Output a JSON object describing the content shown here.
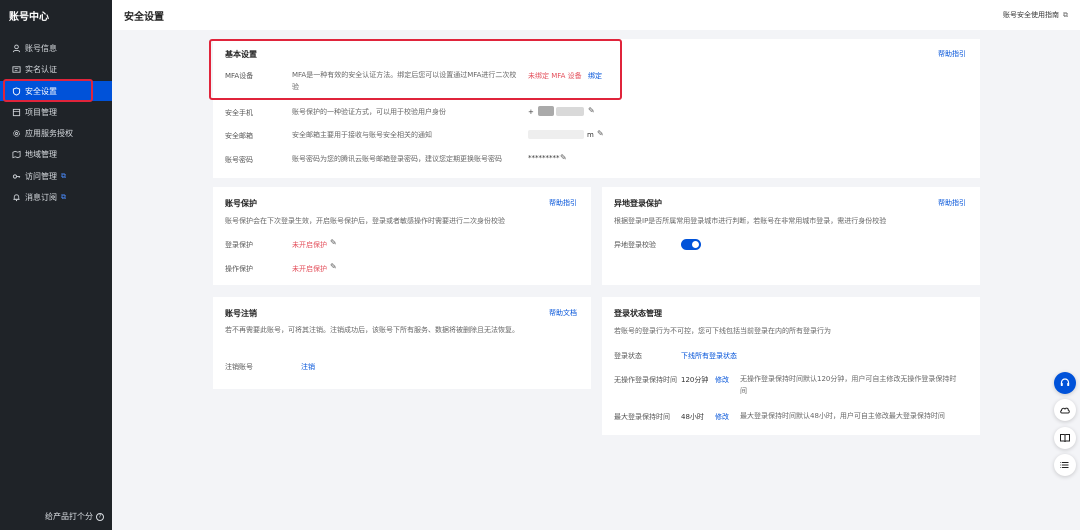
{
  "sidebar": {
    "title": "账号中心",
    "items": [
      {
        "label": "账号信息",
        "icon": "user-icon",
        "active": false,
        "external": false
      },
      {
        "label": "实名认证",
        "icon": "id-card-icon",
        "active": false,
        "external": false
      },
      {
        "label": "安全设置",
        "icon": "shield-icon",
        "active": true,
        "external": false
      },
      {
        "label": "项目管理",
        "icon": "folder-icon",
        "active": false,
        "external": false
      },
      {
        "label": "应用服务授权",
        "icon": "gear-icon",
        "active": false,
        "external": false
      },
      {
        "label": "地域管理",
        "icon": "map-icon",
        "active": false,
        "external": false
      },
      {
        "label": "访问管理",
        "icon": "key-icon",
        "active": false,
        "external": true
      },
      {
        "label": "消息订阅",
        "icon": "bell-icon",
        "active": false,
        "external": true
      }
    ],
    "footer": "给产品打个分",
    "footer_icon": "?"
  },
  "header": {
    "title": "安全设置",
    "guide_link": "账号安全使用指南",
    "external_icon": "⧉"
  },
  "basic": {
    "title": "基本设置",
    "help": "帮助指引",
    "mfa": {
      "label": "MFA设备",
      "desc": "MFA是一种有效的安全认证方法。绑定后您可以设置通过MFA进行二次校验",
      "status": "未绑定 MFA 设备",
      "action": "绑定"
    },
    "phone": {
      "label": "安全手机",
      "desc": "账号保护的一种验证方式，可以用于校验用户身份",
      "value": "+"
    },
    "email": {
      "label": "安全邮箱",
      "desc": "安全邮箱主要用于接收与账号安全相关的通知",
      "value": "m"
    },
    "password": {
      "label": "账号密码",
      "desc": "账号密码为您的腾讯云账号邮箱登录密码，建议您定期更换账号密码",
      "value": "*********"
    }
  },
  "protect": {
    "title": "账号保护",
    "help": "帮助指引",
    "desc": "账号保护会在下次登录生效，开启账号保护后，登录或者敏感操作时需要进行二次身份校验",
    "login": {
      "label": "登录保护",
      "status": "未开启保护"
    },
    "op": {
      "label": "操作保护",
      "status": "未开启保护"
    }
  },
  "remote": {
    "title": "异地登录保护",
    "help": "帮助指引",
    "desc": "根据登录IP是否所属常用登录城市进行判断，若账号在非常用城市登录，需进行身份校验",
    "toggle_label": "异地登录校验",
    "enabled": true
  },
  "cancel": {
    "title": "账号注销",
    "help": "帮助文档",
    "desc": "若不再需要此账号，可将其注销。注销成功后，该账号下所有服务、数据将被删除且无法恢复。",
    "label": "注销账号",
    "action": "注销"
  },
  "session": {
    "title": "登录状态管理",
    "desc": "若账号的登录行为不可控，您可下线包括当前登录在内的所有登录行为",
    "status_label": "登录状态",
    "status_action": "下线所有登录状态",
    "idle": {
      "label": "无操作登录保持时间",
      "value": "120分钟",
      "action": "修改",
      "note": "无操作登录保持时间默认120分钟，用户可自主修改无操作登录保持时间"
    },
    "max": {
      "label": "最大登录保持时间",
      "value": "48小时",
      "action": "修改",
      "note": "最大登录保持时间默认48小时，用户可自主修改最大登录保持时间"
    }
  },
  "colors": {
    "accent": "#0052d9",
    "danger": "#e34d59",
    "sidebar_bg": "#1f2328",
    "highlight": "#e0243b"
  },
  "float_buttons": [
    "headset-icon",
    "cloud-icon",
    "book-icon",
    "list-icon"
  ]
}
